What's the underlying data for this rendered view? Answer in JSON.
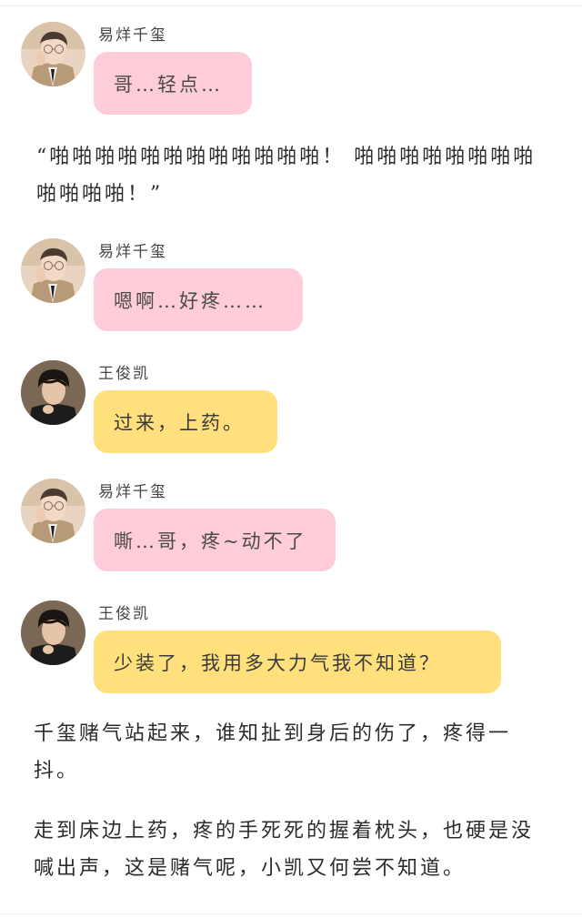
{
  "messages": [
    {
      "sender": "易烊千玺",
      "text": "哥…轻点…",
      "color": "#ffcdd9"
    },
    {
      "sender": "易烊千玺",
      "text": "嗯啊…好疼……",
      "color": "#ffcdd9"
    },
    {
      "sender": "王俊凯",
      "text": "过来，上药。",
      "color": "#ffe07d"
    },
    {
      "sender": "易烊千玺",
      "text": "嘶…哥，疼~动不了",
      "color": "#ffcdd9"
    },
    {
      "sender": "王俊凯",
      "text": "少装了，我用多大力气我不知道？",
      "color": "#ffe07d"
    }
  ],
  "narrations": [
    {
      "text": "“啪啪啪啪啪啪啪啪啪啪啪啪！ 啪啪啪啪啪啪啪啪啪啪啪啪！”"
    },
    {
      "text": "千玺赌气站起来，谁知扯到身后的伤了，疼得一抖。"
    },
    {
      "text": "走到床边上药，疼的手死死的握着枕头，也硬是没喊出声，这是赌气呢，小凯又何尝不知道。"
    }
  ],
  "avatar_icons": {
    "qianxi": "portrait-glasses-suit-icon",
    "junkai": "portrait-dark-hair-icon"
  }
}
